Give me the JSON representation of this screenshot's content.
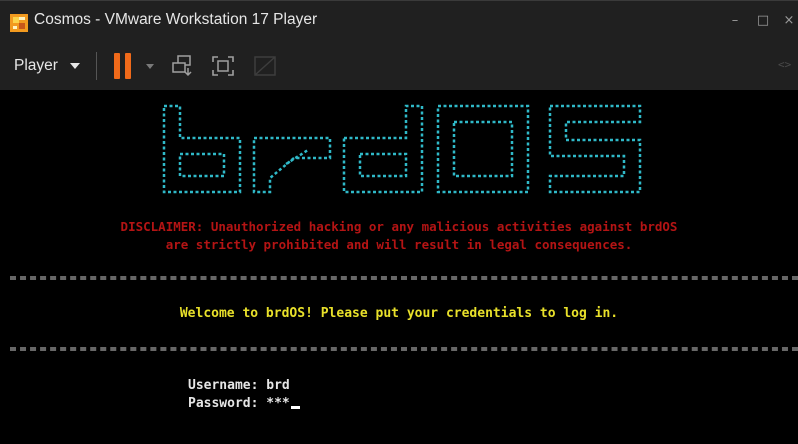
{
  "window": {
    "title": "Cosmos - VMware Workstation 17 Player",
    "minimize": "–",
    "maximize": "□",
    "close": "×"
  },
  "toolbar": {
    "player_label": "Player",
    "right_glyph": "<>",
    "icons": [
      "vmware-player-icon",
      "pause-icon",
      "send-ctrl-alt-del-icon",
      "full-screen-icon",
      "unity-icon"
    ],
    "pause_color": "#f06a1a"
  },
  "console": {
    "logo_text": "brdOS",
    "logo_color": "#2fb9c8",
    "disclaimer_line1": "DISCLAIMER: Unauthorized hacking or any malicious activities against brdOS",
    "disclaimer_line2": "are strictly prohibited and will result in legal consequences.",
    "disclaimer_color": "#b41414",
    "welcome": "Welcome to brdOS! Please put your credentials to log in.",
    "welcome_color": "#e8e02a",
    "username_label": "Username: ",
    "username_value": "brd",
    "password_label": "Password: ",
    "password_value": "***"
  }
}
